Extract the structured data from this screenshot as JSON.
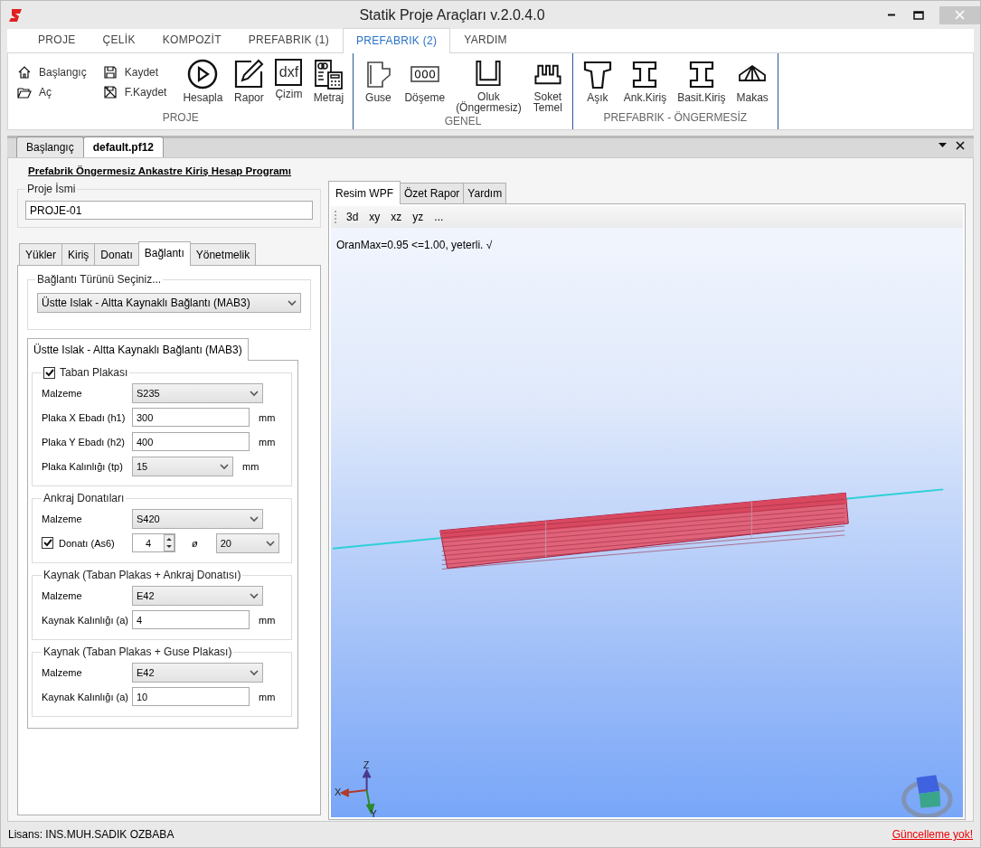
{
  "window": {
    "title": "Statik Proje Araçları v.2.0.4.0"
  },
  "menu_tabs": [
    {
      "label": "PROJE",
      "selected": false
    },
    {
      "label": "ÇELİK",
      "selected": false
    },
    {
      "label": "KOMPOZİT",
      "selected": false
    },
    {
      "label": "PREFABRIK (1)",
      "selected": false
    },
    {
      "label": "PREFABRIK (2)",
      "selected": true
    },
    {
      "label": "YARDIM",
      "selected": false
    }
  ],
  "ribbon_groups": [
    {
      "title": "PROJE",
      "items": [
        {
          "label": "Başlangıç",
          "kind": "home"
        },
        {
          "label": "Aç",
          "kind": "folder"
        },
        {
          "label": "Kaydet",
          "kind": "save"
        },
        {
          "label": "F.Kaydet",
          "kind": "saveas"
        },
        {
          "label": "Hesapla",
          "kind": "play"
        },
        {
          "label": "Rapor",
          "kind": "edit"
        },
        {
          "label": "Çizim",
          "kind": "file",
          "icon_text": "dxf"
        },
        {
          "label": "Metraj",
          "kind": "calc"
        }
      ]
    },
    {
      "title": "GENEL",
      "items": [
        {
          "label": "Guse",
          "kind": "guse"
        },
        {
          "label": "Döşeme",
          "kind": "slab"
        },
        {
          "label": "Oluk (Öngermesiz)",
          "kind": "channel"
        },
        {
          "label": "Soket Temel",
          "kind": "socket"
        }
      ]
    },
    {
      "title": "PREFABRIK - ÖNGERMESİZ",
      "items": [
        {
          "label": "Aşık",
          "kind": "tbeam"
        },
        {
          "label": "Ank.Kiriş",
          "kind": "ibeam"
        },
        {
          "label": "Basit.Kiriş",
          "kind": "ibeam"
        },
        {
          "label": "Makas",
          "kind": "truss"
        }
      ]
    }
  ],
  "doc_tabs": [
    {
      "label": "Başlangıç",
      "selected": false
    },
    {
      "label": "default.pf12",
      "selected": true
    }
  ],
  "form": {
    "heading": "Prefabrik Öngermesiz Ankastre Kiriş Hesap Programı",
    "project_name": {
      "legend": "Proje İsmi",
      "value": "PROJE-01"
    },
    "tabs": [
      {
        "label": "Yükler",
        "selected": false
      },
      {
        "label": "Kiriş",
        "selected": false
      },
      {
        "label": "Donatı",
        "selected": false
      },
      {
        "label": "Bağlantı",
        "selected": true
      },
      {
        "label": "Yönetmelik",
        "selected": false
      }
    ],
    "connection_type": {
      "legend": "Bağlantı Türünü Seçiniz...",
      "value": "Üstte Islak - Altta Kaynaklı Bağlantı (MAB3)"
    },
    "sub_tab": {
      "label": "Üstte Islak - Altta Kaynaklı Bağlantı (MAB3)",
      "selected": true
    },
    "sections": [
      {
        "legend": "Taban Plakası",
        "checked": true,
        "rows": [
          {
            "kind": "select",
            "label": "Malzeme",
            "value": "S235"
          },
          {
            "kind": "input",
            "label": "Plaka X Ebadı (h1)",
            "value": "300",
            "unit": "mm"
          },
          {
            "kind": "input",
            "label": "Plaka Y Ebadı (h2)",
            "value": "400",
            "unit": "mm"
          },
          {
            "kind": "select",
            "label": "Plaka Kalınlığı (tp)",
            "value": "15",
            "unit": "mm"
          }
        ]
      },
      {
        "legend": "Ankraj Donatıları",
        "rows": [
          {
            "kind": "select",
            "label": "Malzeme",
            "value": "S420"
          },
          {
            "kind": "spin",
            "label": "Donatı (As6)",
            "checked": true,
            "value": "4",
            "symbol": "ø",
            "diameter": "20"
          }
        ]
      },
      {
        "legend": "Kaynak (Taban Plakas + Ankraj Donatısı)",
        "rows": [
          {
            "kind": "select",
            "label": "Malzeme",
            "value": "E42"
          },
          {
            "kind": "input",
            "label": "Kaynak Kalınlığı (a)",
            "value": "4",
            "unit": "mm"
          }
        ]
      },
      {
        "legend": "Kaynak (Taban Plakas + Guse Plakası)",
        "rows": [
          {
            "kind": "select",
            "label": "Malzeme",
            "value": "E42"
          },
          {
            "kind": "input",
            "label": "Kaynak Kalınlığı (a)",
            "value": "10",
            "unit": "mm"
          }
        ]
      }
    ]
  },
  "view": {
    "tabs": [
      {
        "label": "Resim WPF",
        "selected": true
      },
      {
        "label": "Özet Rapor",
        "selected": false
      },
      {
        "label": "Yardım",
        "selected": false
      }
    ],
    "toolbar": [
      "3d",
      "xy",
      "xz",
      "yz",
      "..."
    ],
    "result": "OranMax=0.95 <=1.00, yeterli. √",
    "axes": [
      "X",
      "Y",
      "Z"
    ]
  },
  "status_bar": {
    "license": "Lisans: INS.MUH.SADIK OZBABA",
    "update": "Güncelleme yok!"
  }
}
